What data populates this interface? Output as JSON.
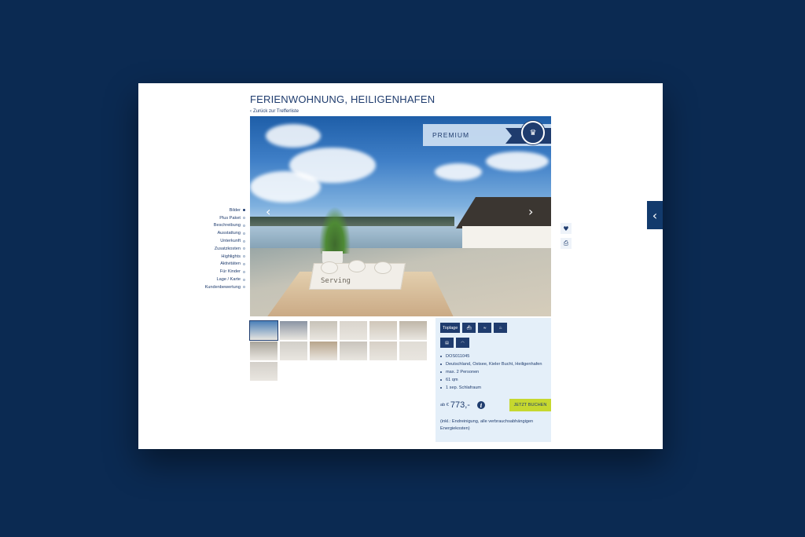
{
  "page": {
    "title": "FERIENWOHNUNG, HEILIGENHAFEN",
    "back_link": "Zurück zur Trefferliste"
  },
  "anchor_nav": {
    "items": [
      {
        "label": "Bilder",
        "active": true
      },
      {
        "label": "Plus Paket",
        "active": false
      },
      {
        "label": "Beschreibung",
        "active": false
      },
      {
        "label": "Ausstattung",
        "active": false
      },
      {
        "label": "Unterkunft",
        "active": false
      },
      {
        "label": "Zusatzkosten",
        "active": false
      },
      {
        "label": "Highlights",
        "active": false
      },
      {
        "label": "Aktivitäten",
        "active": false
      },
      {
        "label": "Für Kinder",
        "active": false
      },
      {
        "label": "Lage / Karte",
        "active": false
      },
      {
        "label": "Kundenbewertung",
        "active": false
      }
    ]
  },
  "hero": {
    "badge": "PREMIUM",
    "tray_text": "Serving",
    "prev_icon": "chevron-left-icon",
    "next_icon": "chevron-right-icon"
  },
  "side_icons": [
    "heart-icon",
    "print-icon"
  ],
  "thumbnails": {
    "count": 13,
    "active_index": 0,
    "tones": [
      "#4a7fb8",
      "#8a94a3",
      "#c7c2b8",
      "#d9d4cc",
      "#cfc6b9",
      "#bfb6a8",
      "#a9a59c",
      "#d2cfc8",
      "#b8a58c",
      "#c9c4bc",
      "#d7d0c6",
      "#e0dcd5",
      "#d4d0ca"
    ]
  },
  "info": {
    "features": [
      {
        "label": "Toplage",
        "icon": "toplage-badge"
      },
      {
        "label": "",
        "icon": "ship-icon"
      },
      {
        "label": "",
        "icon": "pool-icon"
      },
      {
        "label": "",
        "icon": "sauna-icon"
      },
      {
        "label": "",
        "icon": "bed-icon"
      },
      {
        "label": "",
        "icon": "wifi-icon"
      }
    ],
    "details": [
      "DOS011045",
      "Deutschland, Ostsee, Kieler Bucht, Heiligenhafen",
      "max. 2 Personen",
      "61 qm",
      "1 sep. Schlafraum"
    ],
    "price_prefix": "ab €",
    "price": "773,-",
    "book_label": "JETZT BUCHEN",
    "note": "(inkl.: Endreinigung, alle verbrauchsabhängigen Energiekosten)"
  },
  "colors": {
    "background": "#0b2a52",
    "brand": "#1f3c6e",
    "accent": "#c6d82f",
    "panel": "#e4eff9"
  }
}
